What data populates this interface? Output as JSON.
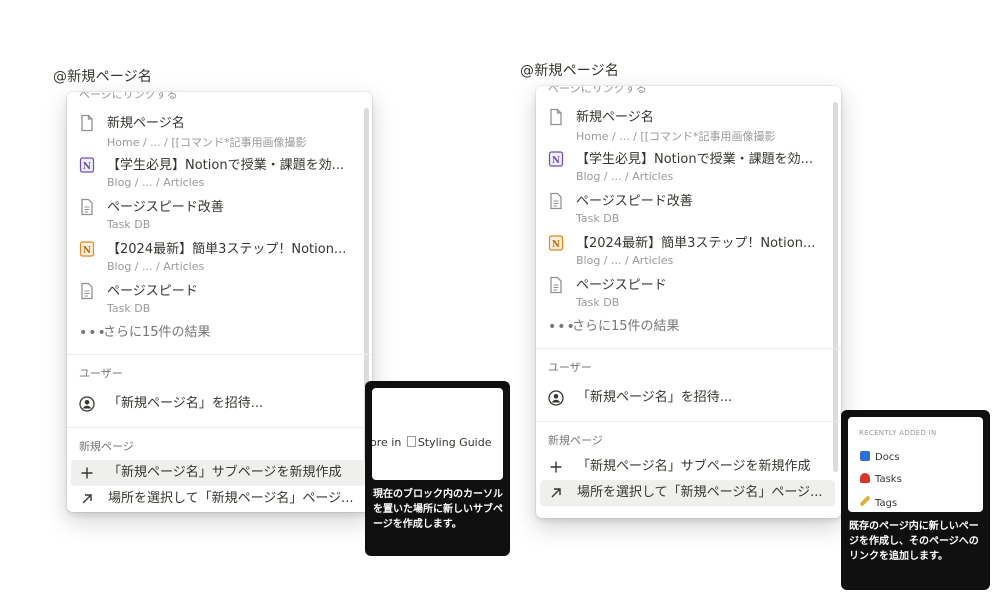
{
  "left": {
    "query": "@新規ページ名",
    "section_link": "ページにリンクする",
    "items": [
      {
        "title": "新規ページ名",
        "path": "Home / ... / [[コマンド*記事用画像撮影",
        "icon": "page-icon"
      },
      {
        "title": "【学生必見】Notionで授業・課題を効...",
        "path": "Blog / ... / Articles",
        "icon": "notion-purple-icon"
      },
      {
        "title": "ページスピード改善",
        "path": "Task DB",
        "icon": "page-text-icon"
      },
      {
        "title": "【2024最新】簡単3ステップ！Notion...",
        "path": "Blog / ... / Articles",
        "icon": "notion-orange-icon"
      },
      {
        "title": "ページスピード",
        "path": "Task DB",
        "icon": "page-text-icon"
      }
    ],
    "more": "さらに15件の結果",
    "section_user": "ユーザー",
    "invite": "「新規ページ名」を招待...",
    "section_new": "新規ページ",
    "create_sub": "「新規ページ名」サブページを新規作成",
    "choose_place": "場所を選択して「新規ページ名」ページ...",
    "tooltip": {
      "preview_text": "ore in",
      "preview_doc": "Styling Guide",
      "desc": "現在のブロック内のカーソルを置いた場所に新しいサブページを作成します。"
    }
  },
  "right": {
    "query": "@新規ページ名",
    "section_link": "ページにリンクする",
    "items": [
      {
        "title": "新規ページ名",
        "path": "Home / ... / [[コマンド*記事用画像撮影",
        "icon": "page-icon"
      },
      {
        "title": "【学生必見】Notionで授業・課題を効...",
        "path": "Blog / ... / Articles",
        "icon": "notion-purple-icon"
      },
      {
        "title": "ページスピード改善",
        "path": "Task DB",
        "icon": "page-text-icon"
      },
      {
        "title": "【2024最新】簡単3ステップ！Notion...",
        "path": "Blog / ... / Articles",
        "icon": "notion-orange-icon"
      },
      {
        "title": "ページスピード",
        "path": "Task DB",
        "icon": "page-text-icon"
      }
    ],
    "more": "さらに15件の結果",
    "section_user": "ユーザー",
    "invite": "「新規ページ名」を招待...",
    "section_new": "新規ページ",
    "create_sub": "「新規ページ名」サブページを新規作成",
    "choose_place": "場所を選択して「新規ページ名」ページ...",
    "tooltip": {
      "recent_label": "RECENTLY ADDED IN",
      "recent_items": [
        {
          "label": "Docs",
          "color": "#2f6fd6"
        },
        {
          "label": "Tags",
          "color": "#e0b23a"
        },
        {
          "label": "Tasks",
          "color": "#d9342b"
        }
      ],
      "desc": "既存のページ内に新しいページを作成し、そのページへのリンクを追加します。"
    }
  },
  "colors": {
    "notion_purple": "#6b4fbb",
    "notion_orange": "#e0881d",
    "text": "#37352f",
    "muted": "#9b9a97",
    "highlight": "#efefee",
    "tooltip_bg": "#0f0f0f"
  }
}
